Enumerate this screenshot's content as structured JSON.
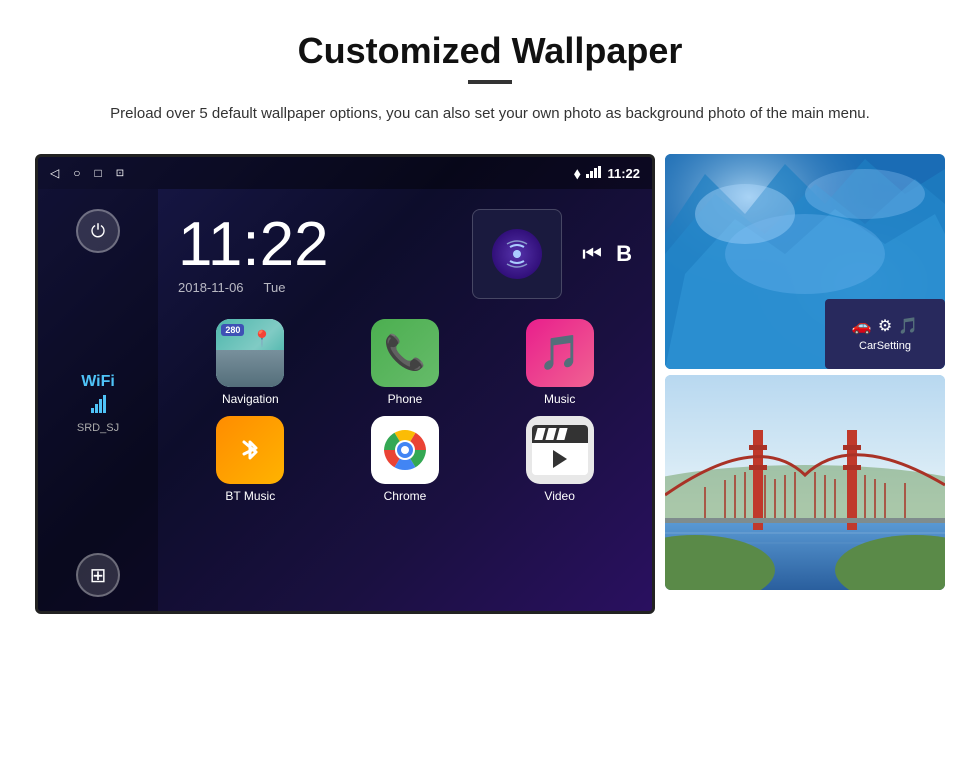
{
  "page": {
    "title": "Customized Wallpaper",
    "divider": "—",
    "description": "Preload over 5 default wallpaper options, you can also set your own photo as background photo of the main menu."
  },
  "statusBar": {
    "time": "11:22",
    "icons": {
      "nav_back": "◁",
      "nav_home": "○",
      "nav_recent": "□",
      "nav_screenshot": "⊡",
      "location": "⬧",
      "wifi": "▾",
      "time_display": "11:22"
    }
  },
  "sidebar": {
    "power_label": "⏻",
    "wifi_label": "WiFi",
    "wifi_signal": "▌▌▌",
    "wifi_ssid": "SRD_SJ",
    "apps_label": "⊞"
  },
  "clock": {
    "time": "11:22",
    "date": "2018-11-06",
    "day": "Tue"
  },
  "mediaControls": {
    "prev": "⏮",
    "label": "B"
  },
  "apps": [
    {
      "id": "navigation",
      "label": "Navigation",
      "badge": "280",
      "type": "navigation"
    },
    {
      "id": "phone",
      "label": "Phone",
      "type": "phone"
    },
    {
      "id": "music",
      "label": "Music",
      "type": "music"
    },
    {
      "id": "bt-music",
      "label": "BT Music",
      "type": "bt-music"
    },
    {
      "id": "chrome",
      "label": "Chrome",
      "type": "chrome"
    },
    {
      "id": "video",
      "label": "Video",
      "type": "video"
    }
  ],
  "carSetting": {
    "label": "CarSetting"
  },
  "wallpapers": {
    "top_alt": "Ice/glacier wallpaper",
    "bottom_alt": "Golden Gate Bridge wallpaper"
  }
}
